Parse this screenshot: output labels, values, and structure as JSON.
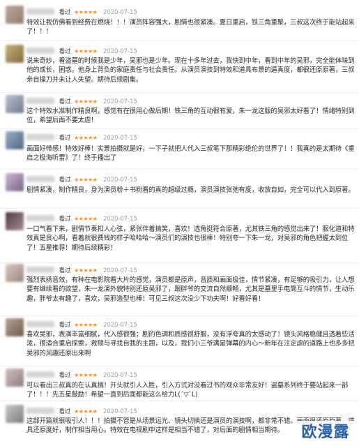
{
  "colors": {
    "star": "#ff8a1f",
    "date": "#9a9a9a",
    "text": "#2a2a2a",
    "watermark": "#2b5fa8"
  },
  "comments": [
    {
      "status": "看过",
      "stars": "★★★★★",
      "date": "2020-07-15",
      "text": "特效让我仿佛看到经费在燃烧！！！演员阵容强大，剧情也很紧凑。夏日重启，铁三角重聚，三叔这次终于能站起来了！！！",
      "avatar": [
        "#c0a89e",
        "#8e7a70"
      ]
    },
    {
      "status": "看过",
      "stars": "★★★★★",
      "date": "2020-07-15",
      "text": "说来奇妙，看盗墓的时候我是少年，吴邪也是少年。现在十多年过去，我快到中年，看到中年的吴邪，完全能体味到他的成长，困惑，他身上背负的家庭责任与社会责任。从演员演技到特效和道具布景的逼真度，都很还原原著，三叔亲自操刀并未让人失望。期待后续剧集。",
      "avatar": [
        "#c9b27a",
        "#7f6a3c"
      ]
    },
    {
      "status": "看过",
      "stars": "★★★★★",
      "date": "2020-07-15",
      "text": "这个特效水准制作精良啊，感觉有在很用心做后期！铁三角的互动很有爱，朱一龙这版的吴邪太好看了！情绪特别到位，希望后面不要太虐！",
      "avatar": [
        "#b9c2cf",
        "#6f7c8c"
      ]
    },
    {
      "status": "看过",
      "stars": "★★★★★",
      "date": "2020-07-15",
      "text": "画面好带感！特效好棒！实景拍摄就是好，一下子就把人代入三叔笔下那精彩绝伦的世界了！！我真的是太期待《重启之极海听雷》了！终于播出了",
      "avatar": [
        "#9ab0c8",
        "#4f6583"
      ]
    },
    {
      "status": "看过",
      "stars": "★★★★★",
      "date": "2020-07-15",
      "text": "剧情紧凑，制作精良，身为演员粉＋书粉看的真的超级过瘾，演员演技张弛有度，收放自如，完全可以代入到原著。",
      "avatar": [
        "#c7b6d1",
        "#7b6688"
      ]
    },
    {
      "status": "看过",
      "stars": "★★★★★",
      "date": "2020-07-15",
      "text": "一口气看下来，剧情节奏扣人心弦，紧张伴着搞笑，喜欢！选角挺符合原著，尤其铁三角的感觉出来了！服化道和特效真是良心啊，看着就很费钱的样子哈哈哈～演员们的演技也很棒！特别夸一下朱一龙，对吴邪的角色把握太到位了！五星推荐！期待后续精彩！",
      "avatar": [
        "#4a3b3f",
        "#a88d94"
      ]
    },
    {
      "status": "看过",
      "stars": "★★★★★",
      "date": "2020-07-15",
      "text": "强烈表扬音效，有种在电影院看大片的感觉，演员都是原声，音质和画面极佳，情节紧凑，有足够的吸引力，让人想要有继续看的欲望，朱一龙演外貌特别还原吴邪了，跟胖爷的交流自然顺畅，尤其是墓里手电筒互斗的情节，生动乐趣，胖爷太有趣了，喜欢，吴邪造型也棒！可见三叔这次没少下功夫啊！好看好看！",
      "avatar": [
        "#d8c9c0",
        "#9c8980"
      ]
    },
    {
      "status": "看过",
      "stars": "★★★★★",
      "date": "2020-07-15",
      "text": "喜欢吴邪，表演丰富细腻，代入感很强；剧的色调和质感很舒服，没有浮夸真的太感动了！镜头风格稳健且透着些活泼，很适合重启探索，救赎与寻找自我的主题，以及，我们小三爷满是弹幕的内心～新年在注定虐的道路上也多多把吴邪的风趣还原出来啊",
      "avatar": [
        "#b9a493",
        "#6d5a4c"
      ]
    },
    {
      "status": "看过",
      "stars": "★★★★★",
      "date": "2020-07-15",
      "text": "可以看出三叔真的在认真搞！开头就引人入胜，引入方式对没看过书的观众非常友好！盗墓系列终于要站起来一部了！！！先五星鼓励！希望一直到后面都能这么给力L(ˊ▽ˋL)",
      "avatar": [
        "#d2c2c2",
        "#8f7d7d"
      ]
    },
    {
      "status": "看过",
      "stars": "★★★★★",
      "date": "2020-07-15",
      "text": "这部开篇就很吸引人！！！拍摄不管是从场景运光、镜头切换还是演员的演技啊，都非常不错。画面很还原原著，道具还原度好，制作相当用心。特效在电视剧中这样是相当不错了，对后面的剧情相当期待。",
      "avatar": [
        "#c9c9c9",
        "#7c7c7c"
      ]
    }
  ],
  "watermark": "欧漫露"
}
